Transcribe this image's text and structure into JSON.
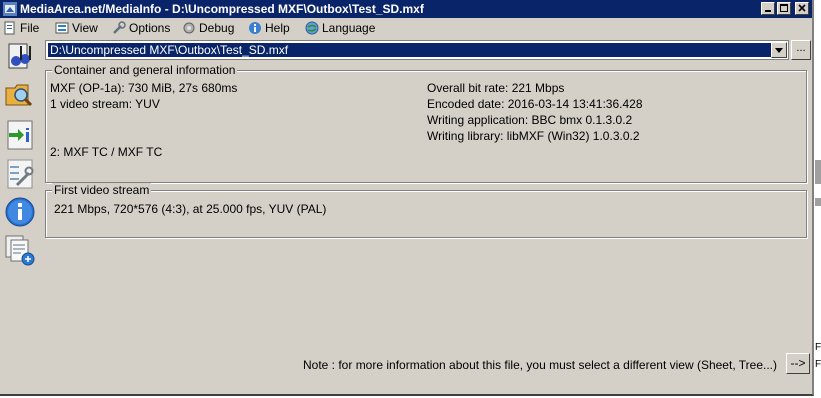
{
  "window": {
    "title": "MediaArea.net/MediaInfo - D:\\Uncompressed MXF\\Outbox\\Test_SD.mxf",
    "minimize_glyph": "_",
    "maximize_glyph": "□",
    "close_glyph": "✕"
  },
  "menu": {
    "file": "File",
    "view": "View",
    "options": "Options",
    "debug": "Debug",
    "help": "Help",
    "language": "Language"
  },
  "file_path": "D:\\Uncompressed MXF\\Outbox\\Test_SD.mxf",
  "browse_label": "...",
  "container": {
    "legend": "Container and general information",
    "left": [
      "MXF (OP-1a): 730 MiB, 27s 680ms",
      "1 video stream: YUV",
      "2: MXF TC / MXF TC"
    ],
    "right": [
      "Overall bit rate: 221 Mbps",
      "Encoded date: 2016-03-14 13:41:36.428",
      "Writing application: BBC bmx 0.1.3.0.2",
      "Writing library: libMXF (Win32) 1.0.3.0.2"
    ]
  },
  "video": {
    "legend": "First video stream",
    "line": "221 Mbps, 720*576 (4:3), at 25.000 fps, YUV (PAL)"
  },
  "note": "Note : for more information about this file, you must select a different view (Sheet, Tree...)",
  "next_button": "-->",
  "background_fragments": [
    "F",
    "F"
  ],
  "colors": {
    "titlebar": "#0a246a",
    "chrome": "#d4d0c8",
    "selection": "#0a246a"
  },
  "icons": {
    "app": "mediainfo-app-icon",
    "open_file": "open-file-icon",
    "open_folder": "open-folder-icon",
    "export": "export-icon",
    "preferences": "preferences-icon",
    "about": "about-icon",
    "help_topics": "help-topics-icon"
  }
}
